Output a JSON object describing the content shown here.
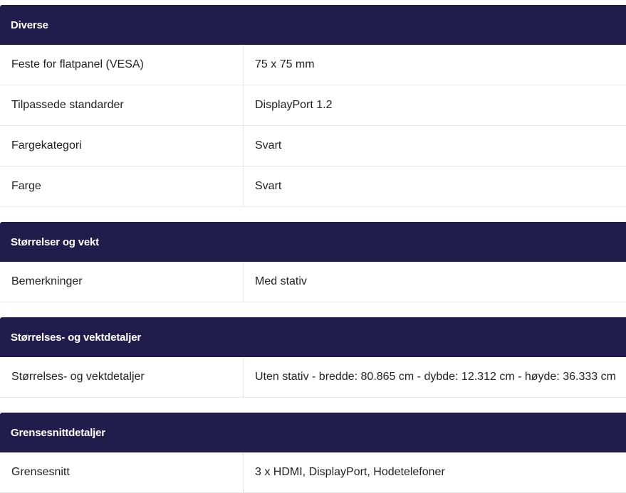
{
  "sections": [
    {
      "title": "Diverse",
      "rows": [
        {
          "key": "Feste for flatpanel (VESA)",
          "value": "75 x 75 mm"
        },
        {
          "key": "Tilpassede standarder",
          "value": "DisplayPort 1.2"
        },
        {
          "key": "Fargekategori",
          "value": "Svart"
        },
        {
          "key": "Farge",
          "value": "Svart"
        }
      ]
    },
    {
      "title": "Størrelser og vekt",
      "rows": [
        {
          "key": "Bemerkninger",
          "value": "Med stativ"
        }
      ]
    },
    {
      "title": "Størrelses- og vektdetaljer",
      "rows": [
        {
          "key": "Størrelses- og vektdetaljer",
          "value": "Uten stativ - bredde: 80.865 cm - dybde: 12.312 cm - høyde: 36.333 cm"
        }
      ]
    },
    {
      "title": "Grensesnittdetaljer",
      "rows": [
        {
          "key": "Grensesnitt",
          "value": "3 x HDMI, DisplayPort, Hodetelefoner"
        }
      ]
    }
  ],
  "colors": {
    "header_bg": "#211c4c",
    "header_text": "#ffffff",
    "row_border": "#e6e6e6",
    "text": "#222222"
  }
}
